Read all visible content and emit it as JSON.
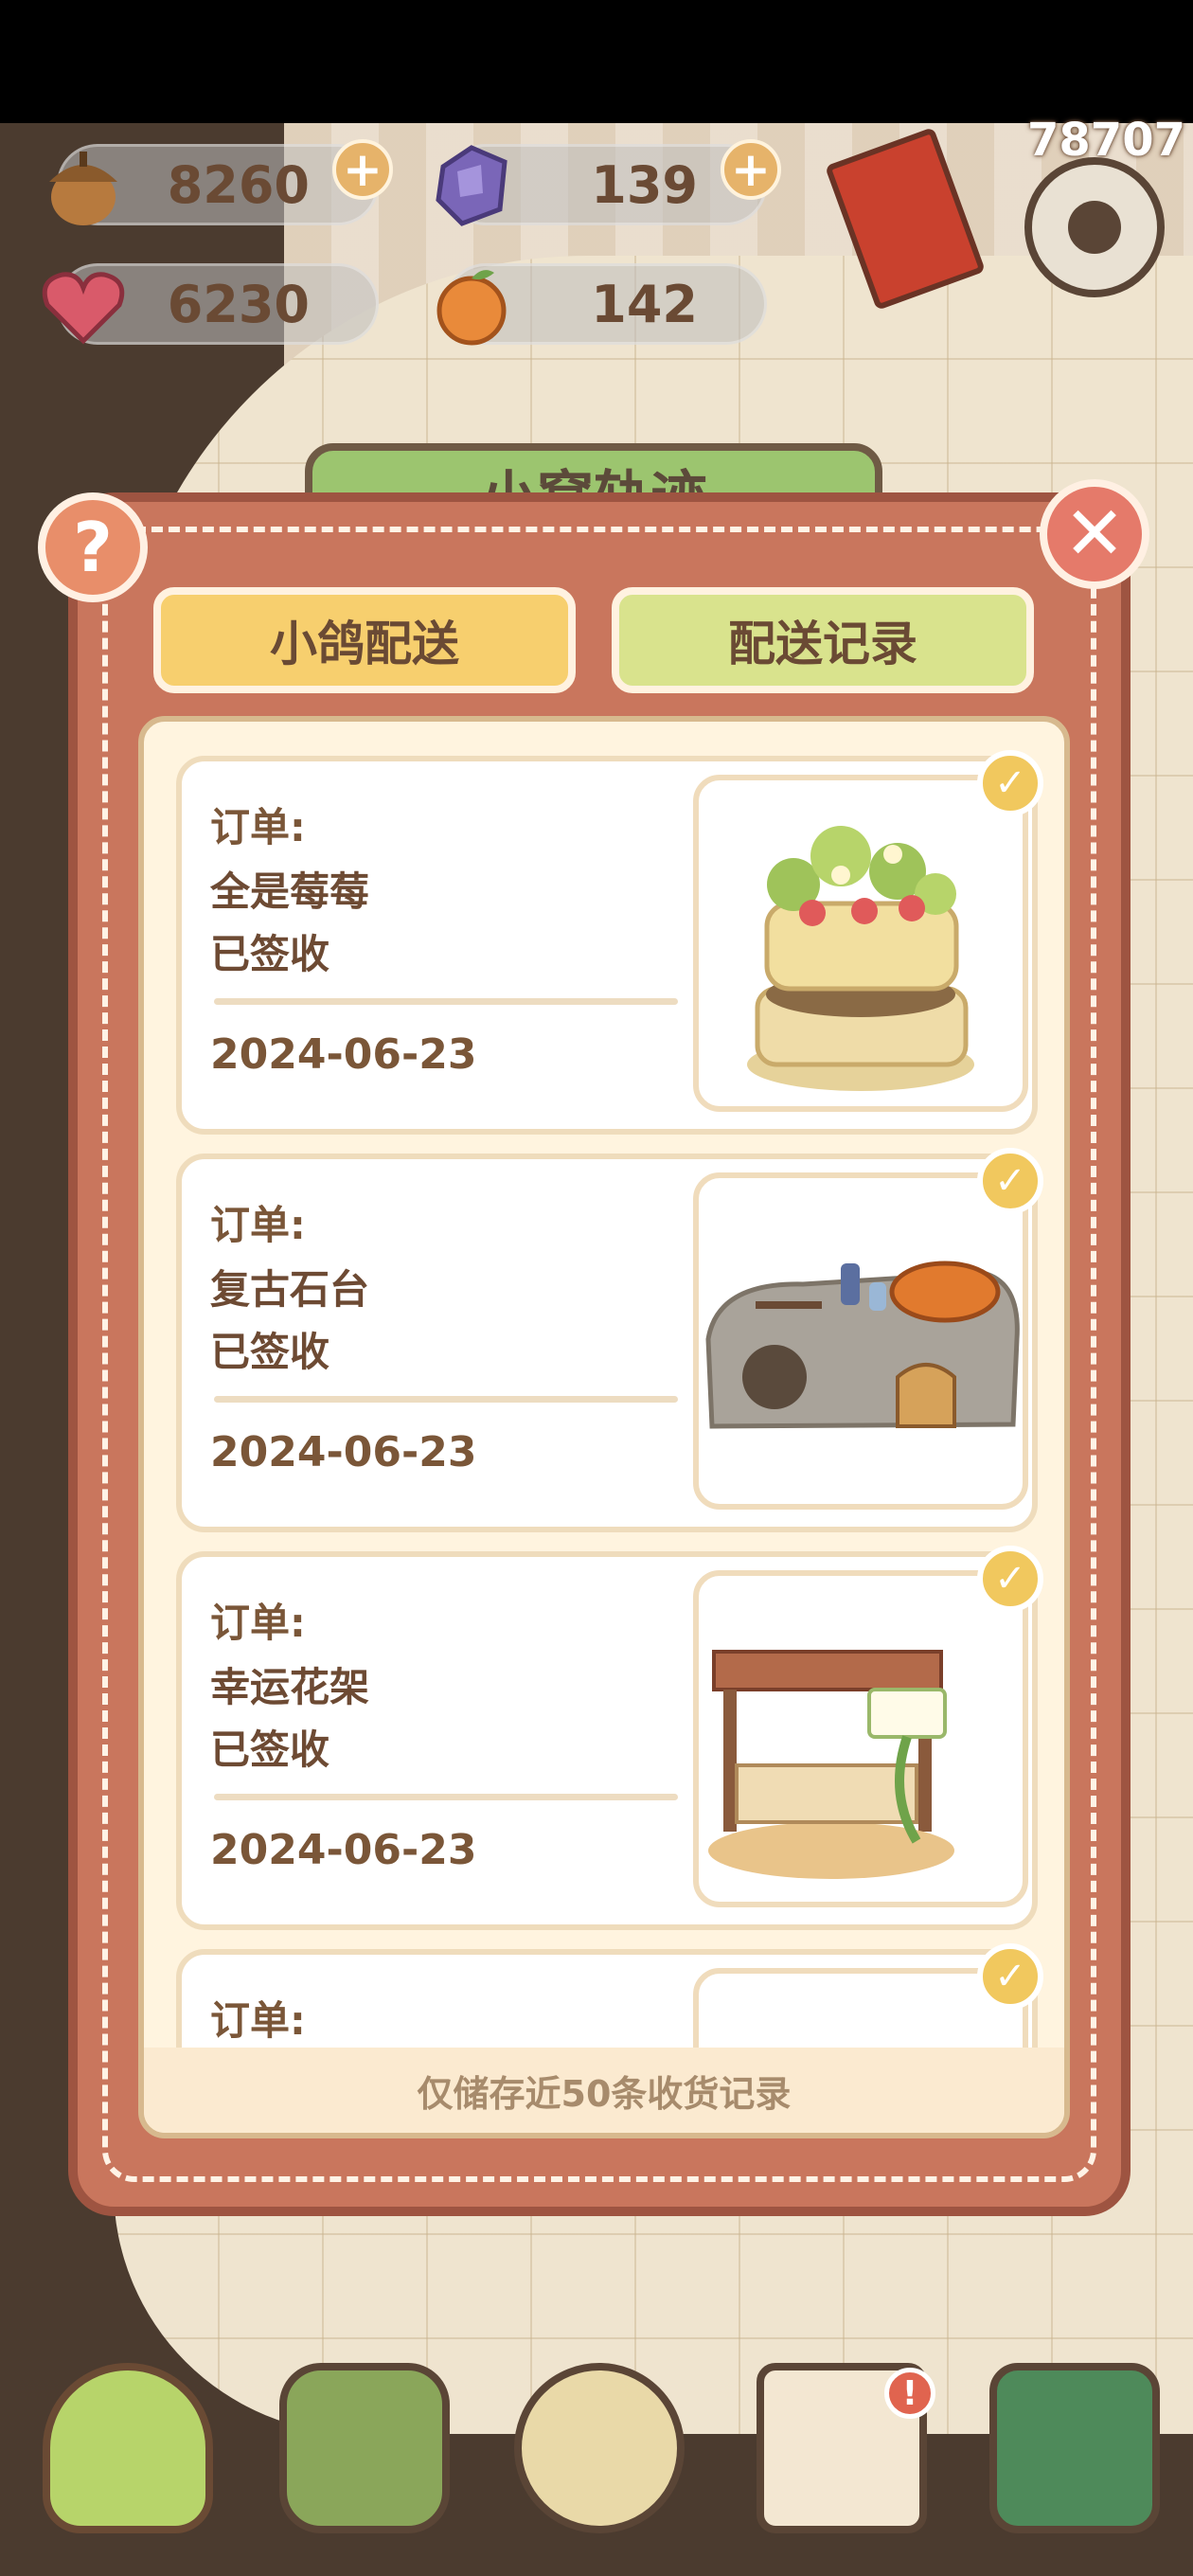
{
  "hud": {
    "acorn_count": "8260",
    "gem_count": "139",
    "heart_count": "6230",
    "orange_count": "142",
    "player_id": "78707",
    "plus_symbol": "+"
  },
  "banner": {
    "title": "小窝轨迹"
  },
  "dialog": {
    "help_symbol": "?",
    "close_symbol": "✕",
    "tabs": [
      {
        "label": "小鸽配送"
      },
      {
        "label": "配送记录"
      }
    ],
    "orders": [
      {
        "label": "订单:",
        "name": "全是莓莓",
        "status": "已签收",
        "date": "2024-06-23"
      },
      {
        "label": "订单:",
        "name": "复古石台",
        "status": "已签收",
        "date": "2024-06-23"
      },
      {
        "label": "订单:",
        "name": "幸运花架",
        "status": "已签收",
        "date": "2024-06-23"
      },
      {
        "label": "订单:"
      }
    ],
    "footer_note": "仅储存近50条收货记录"
  },
  "nav": {
    "items": [
      "home-icon",
      "mail-icon",
      "gacha-icon",
      "tasks-icon",
      "map-icon"
    ],
    "tasks_badge": "!"
  },
  "colors": {
    "dialog_bg": "#c9765d",
    "tab_active": "#f7cf6e",
    "tab_inactive": "#d9e38d",
    "text_brown": "#6d4a33",
    "check": "#f1c85e"
  }
}
